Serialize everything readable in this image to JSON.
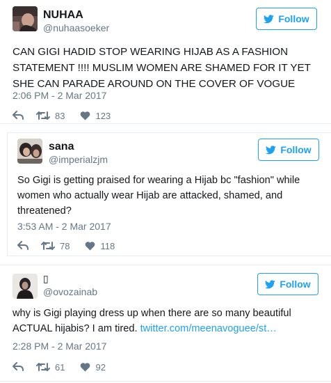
{
  "colors": {
    "brand_blue": "#1da1f2",
    "text_primary": "#14171a",
    "text_secondary": "#657786",
    "divider": "#e6ecf0"
  },
  "tweets": [
    {
      "display_name": "NUHAA",
      "handle": "@nuhaasoeker",
      "follow_label": "Follow",
      "text": "CAN GIGI HADID STOP WEARING HIJAB AS A FASHION STATEMENT !!!! MUSLIM WOMEN ARE SHAMED FOR IT YET SHE CAN PARADE AROUND ON THE COVER OF VOGUE",
      "timestamp": "2:06 PM - 2 Mar 2017",
      "retweets": "83",
      "likes": "123",
      "icons": [
        "avatar",
        "twitter-bird-icon",
        "reply-icon",
        "retweet-icon",
        "heart-icon"
      ]
    },
    {
      "display_name": "sana",
      "handle": "@imperialzjm",
      "follow_label": "Follow",
      "text": "So Gigi is getting praised for wearing a Hijab bc \"fashion\" while women who actually wear Hijab are attacked, shamed, and threatened?",
      "timestamp": "3:53 AM - 2 Mar 2017",
      "retweets": "78",
      "likes": "118"
    },
    {
      "display_name": "▯",
      "handle": "@ovozainab",
      "follow_label": "Follow",
      "text": "why is Gigi playing dress up when there are so many beautiful ACTUAL hijabis? I am tired. ",
      "link_text": "twitter.com/meenavoguee/st…",
      "timestamp": "2:28 PM - 2 Mar 2017",
      "retweets": "61",
      "likes": "92"
    }
  ]
}
